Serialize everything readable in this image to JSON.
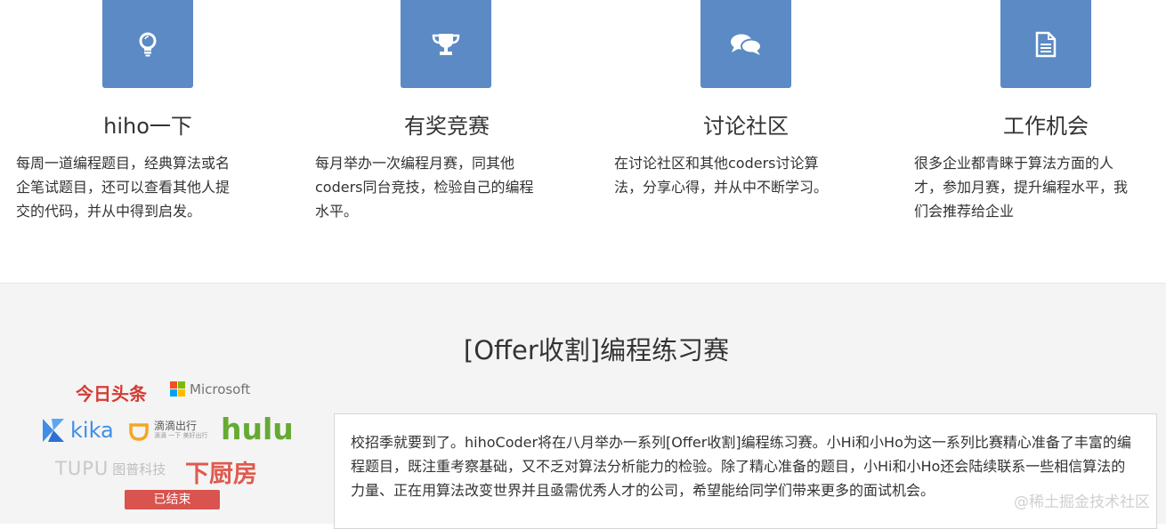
{
  "features": [
    {
      "icon": "lightbulb-icon",
      "title": "hiho一下",
      "desc": [
        "每周一道编程题目，经典算法或名",
        "企笔试题目，还可以查看其他人提",
        "交的代码，并从中得到启发。"
      ]
    },
    {
      "icon": "trophy-icon",
      "title": "有奖竞赛",
      "desc": [
        "每月举办一次编程月赛，同其他",
        "coders同台竞技，检验自己的编程",
        "水平。"
      ]
    },
    {
      "icon": "comments-icon",
      "title": "讨论社区",
      "desc": [
        "在讨论社区和其他coders讨论算",
        "法，分享心得，并从中不断学习。"
      ]
    },
    {
      "icon": "document-icon",
      "title": "工作机会",
      "desc": [
        "很多企业都青睐于算法方面的人",
        "才，参加月赛，提升编程水平，我",
        "们会推荐给企业"
      ]
    }
  ],
  "contest": {
    "title": "[Offer收割]编程练习赛",
    "status": "已结束",
    "description": "校招季就要到了。hihoCoder将在八月举办一系列[Offer收割]编程练习赛。小Hi和小Ho为这一系列比赛精心准备了丰富的编程题目，既注重考察基础，又不乏对算法分析能力的检验。除了精心准备的题目，小Hi和小Ho还会陆续联系一些相信算法的力量、正在用算法改变世界并且亟需优秀人才的公司，希望能给同学们带来更多的面试机会。",
    "sponsors": {
      "toutiao": "今日头条",
      "microsoft": "Microsoft",
      "kika": "kika",
      "didi": "滴滴出行",
      "didi_sub": "滴滴 一下 美好出行",
      "hulu": "hulu",
      "tupu": "TUPU",
      "tupu_cn": "图普科技",
      "xiachufang": "下厨房"
    }
  },
  "watermark": "@稀土掘金技术社区",
  "colors": {
    "icon_bg": "#5b8ac4",
    "badge": "#d9534f",
    "toutiao": "#d43c33",
    "hulu": "#66aa33",
    "kika": "#3f8ee8",
    "didi": "#f5a623",
    "xiachufang": "#e05a4f"
  }
}
